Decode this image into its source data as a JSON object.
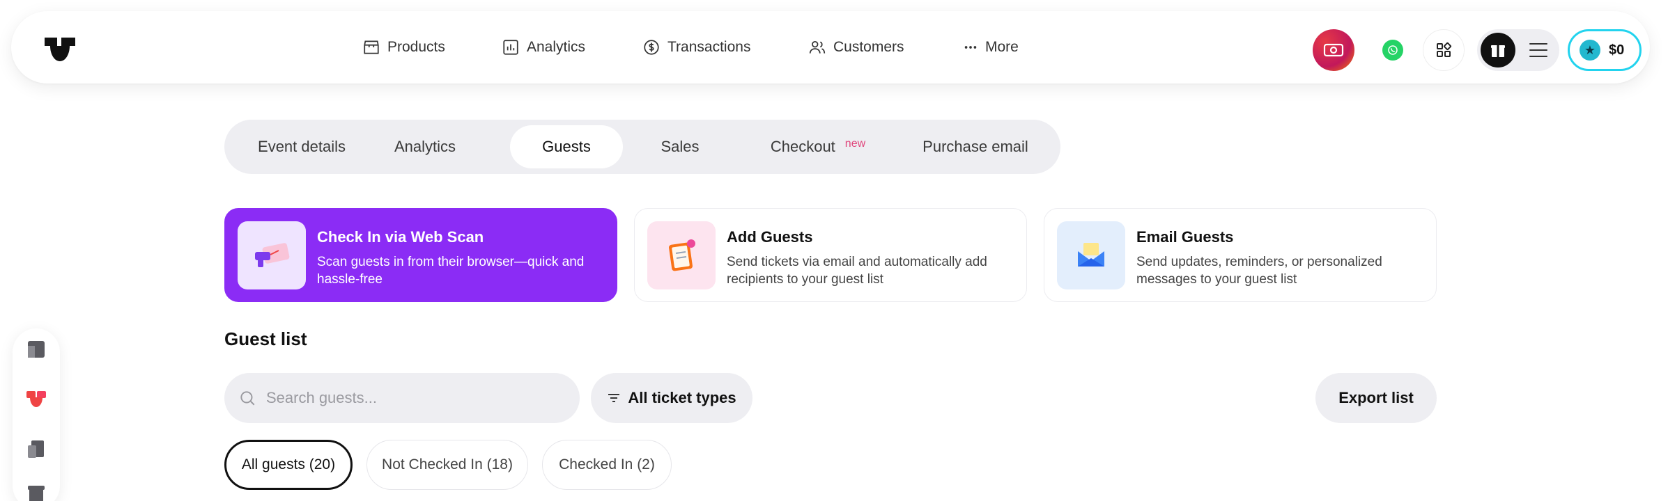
{
  "nav": {
    "items": [
      {
        "label": "Products",
        "icon": "store-icon"
      },
      {
        "label": "Analytics",
        "icon": "bar-chart-icon"
      },
      {
        "label": "Transactions",
        "icon": "dollar-circle-icon"
      },
      {
        "label": "Customers",
        "icon": "users-icon"
      },
      {
        "label": "More",
        "icon": "dots-icon"
      }
    ]
  },
  "header": {
    "balance": "$0"
  },
  "tabs": [
    {
      "label": "Event details"
    },
    {
      "label": "Analytics"
    },
    {
      "label": "Guests",
      "active": true
    },
    {
      "label": "Sales"
    },
    {
      "label": "Checkout",
      "badge": "new"
    },
    {
      "label": "Purchase email"
    }
  ],
  "cards": [
    {
      "title": "Check In via Web Scan",
      "desc": "Scan guests in from their browser—quick and hassle-free"
    },
    {
      "title": "Add Guests",
      "desc": "Send tickets via email and automatically add recipients to your guest list"
    },
    {
      "title": "Email Guests",
      "desc": "Send updates, reminders, or personalized messages to your guest list"
    }
  ],
  "guest_list": {
    "title": "Guest list",
    "search_placeholder": "Search guests...",
    "filter_label": "All ticket types",
    "export_label": "Export list",
    "chips": [
      {
        "label": "All guests (20)",
        "active": true
      },
      {
        "label": "Not Checked In (18)"
      },
      {
        "label": "Checked In (2)"
      }
    ]
  },
  "colors": {
    "accent_purple": "#8b2cf5",
    "balance_border": "#22d3ee",
    "new_badge": "#e0457b"
  }
}
